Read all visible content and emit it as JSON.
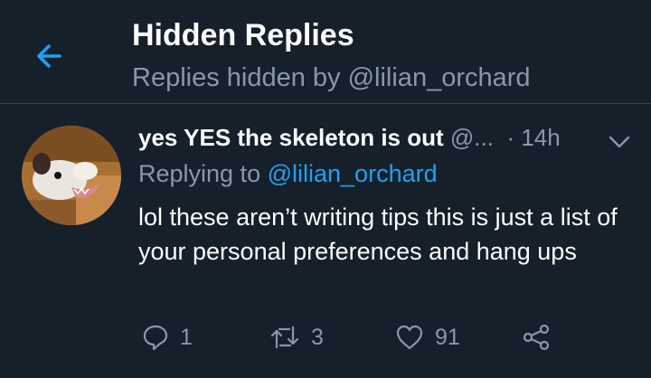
{
  "header": {
    "title": "Hidden Replies",
    "subtitle": "Replies hidden by @lilian_orchard"
  },
  "tweet": {
    "display_name": "yes YES the skeleton is out",
    "handle": "@...",
    "separator": "·",
    "time": "14h",
    "replying_prefix": "Replying to",
    "replying_handle": "@lilian_orchard",
    "text": "lol these aren’t writing tips this is just a list of your personal preferences and hang ups",
    "actions": {
      "reply_count": "1",
      "retweet_count": "3",
      "like_count": "91"
    }
  },
  "icons": [
    "back-arrow-icon",
    "chevron-down-icon",
    "reply-icon",
    "retweet-icon",
    "like-icon",
    "share-icon"
  ],
  "colors": {
    "background": "#15202b",
    "accent": "#1da1f2",
    "secondary_text": "#8899a6",
    "divider": "#38444d"
  }
}
